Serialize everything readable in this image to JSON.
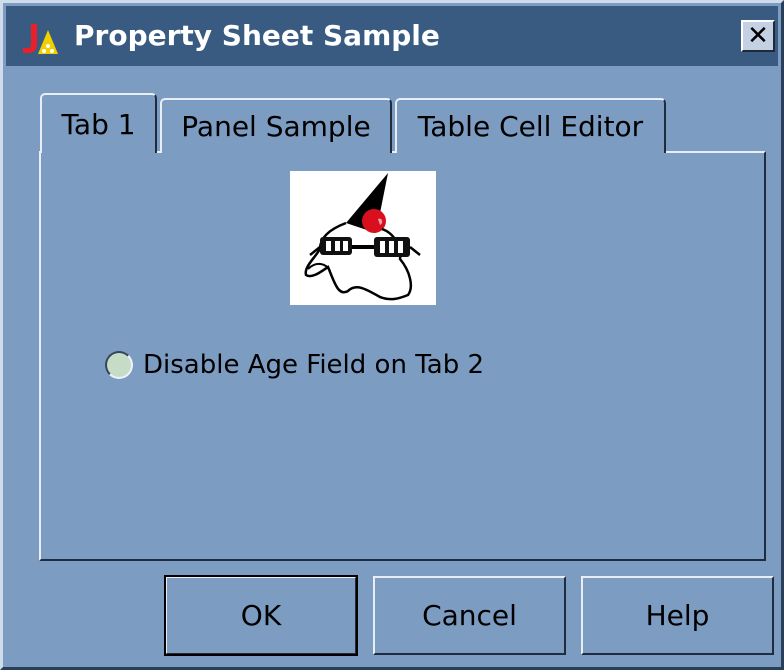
{
  "window": {
    "title": "Property Sheet Sample",
    "icon": "java-applet-icon",
    "close_label": "✕"
  },
  "tabs": [
    {
      "label": "Tab 1",
      "selected": true
    },
    {
      "label": "Panel Sample",
      "selected": false
    },
    {
      "label": "Table Cell Editor",
      "selected": false
    }
  ],
  "content": {
    "image": "duke-mascot-image",
    "radio": {
      "label": "Disable Age Field on Tab 2",
      "checked": false
    }
  },
  "buttons": {
    "ok": "OK",
    "cancel": "Cancel",
    "help": "Help"
  },
  "colors": {
    "background": "#7c9cc2",
    "titlebar": "#395b82"
  }
}
